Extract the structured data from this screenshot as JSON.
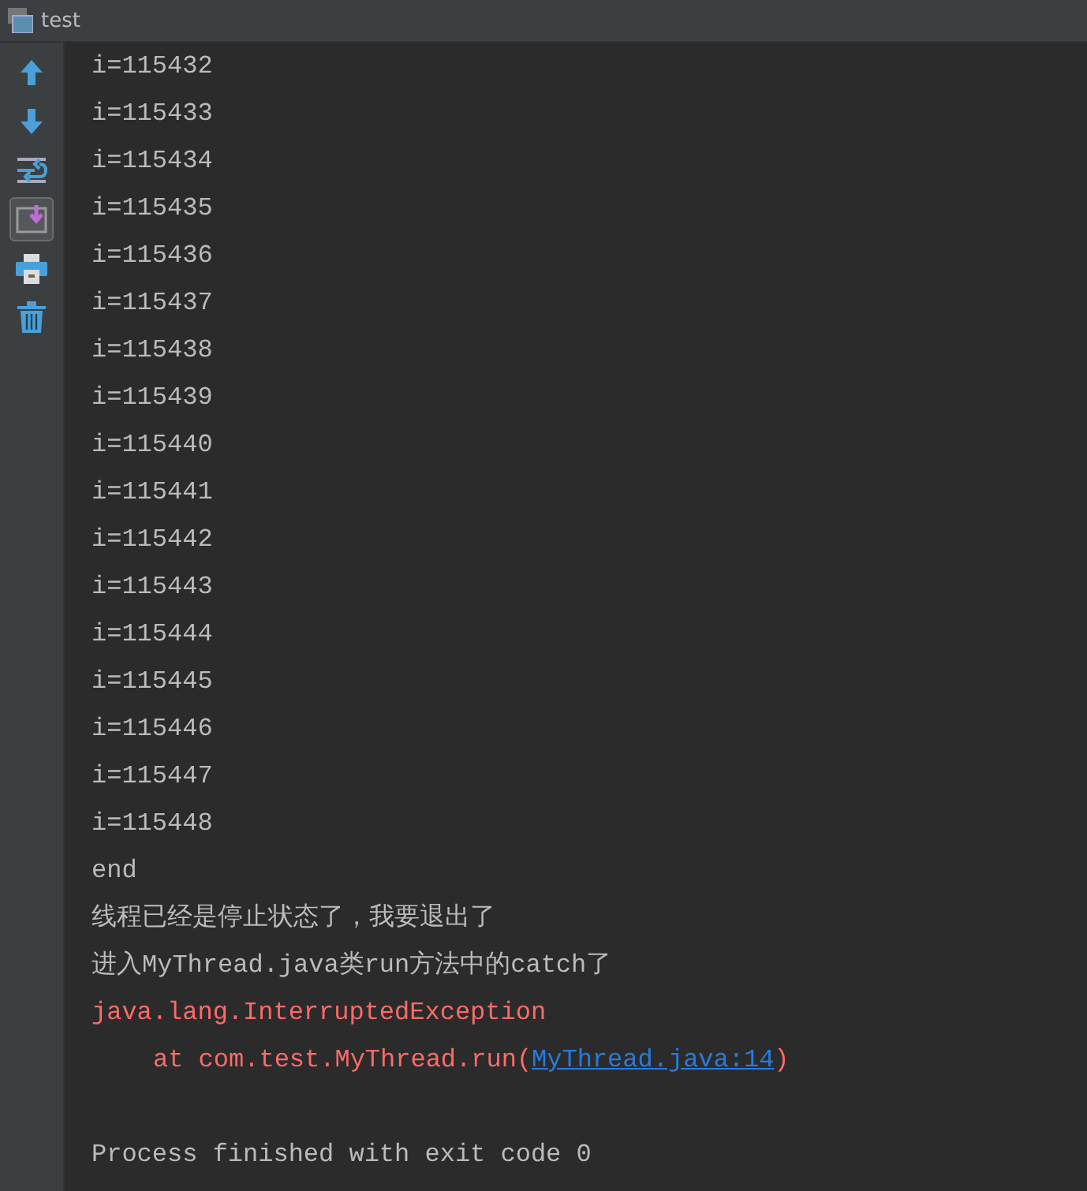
{
  "window": {
    "title": "test"
  },
  "toolbar": [
    {
      "kind": "up",
      "selected": false
    },
    {
      "kind": "down",
      "selected": false
    },
    {
      "kind": "wrap",
      "selected": false
    },
    {
      "kind": "scroll-end",
      "selected": true
    },
    {
      "kind": "print",
      "selected": false
    },
    {
      "kind": "trash",
      "selected": false
    }
  ],
  "console_lines": [
    {
      "kind": "out",
      "text": "i=115432"
    },
    {
      "kind": "out",
      "text": "i=115433"
    },
    {
      "kind": "out",
      "text": "i=115434"
    },
    {
      "kind": "out",
      "text": "i=115435"
    },
    {
      "kind": "out",
      "text": "i=115436"
    },
    {
      "kind": "out",
      "text": "i=115437"
    },
    {
      "kind": "out",
      "text": "i=115438"
    },
    {
      "kind": "out",
      "text": "i=115439"
    },
    {
      "kind": "out",
      "text": "i=115440"
    },
    {
      "kind": "out",
      "text": "i=115441"
    },
    {
      "kind": "out",
      "text": "i=115442"
    },
    {
      "kind": "out",
      "text": "i=115443"
    },
    {
      "kind": "out",
      "text": "i=115444"
    },
    {
      "kind": "out",
      "text": "i=115445"
    },
    {
      "kind": "out",
      "text": "i=115446"
    },
    {
      "kind": "out",
      "text": "i=115447"
    },
    {
      "kind": "out",
      "text": "i=115448"
    },
    {
      "kind": "out",
      "text": "end"
    },
    {
      "kind": "out",
      "text": "线程已经是停止状态了，我要退出了"
    },
    {
      "kind": "out",
      "text": "进入MyThread.java类run方法中的catch了"
    },
    {
      "kind": "err",
      "text": "java.lang.InterruptedException"
    },
    {
      "kind": "trace",
      "text": "at com.test.MyThread.run(",
      "link": "MyThread.java:14",
      "suffix": ")"
    },
    {
      "kind": "blank"
    },
    {
      "kind": "out",
      "text": "Process finished with exit code 0"
    }
  ]
}
